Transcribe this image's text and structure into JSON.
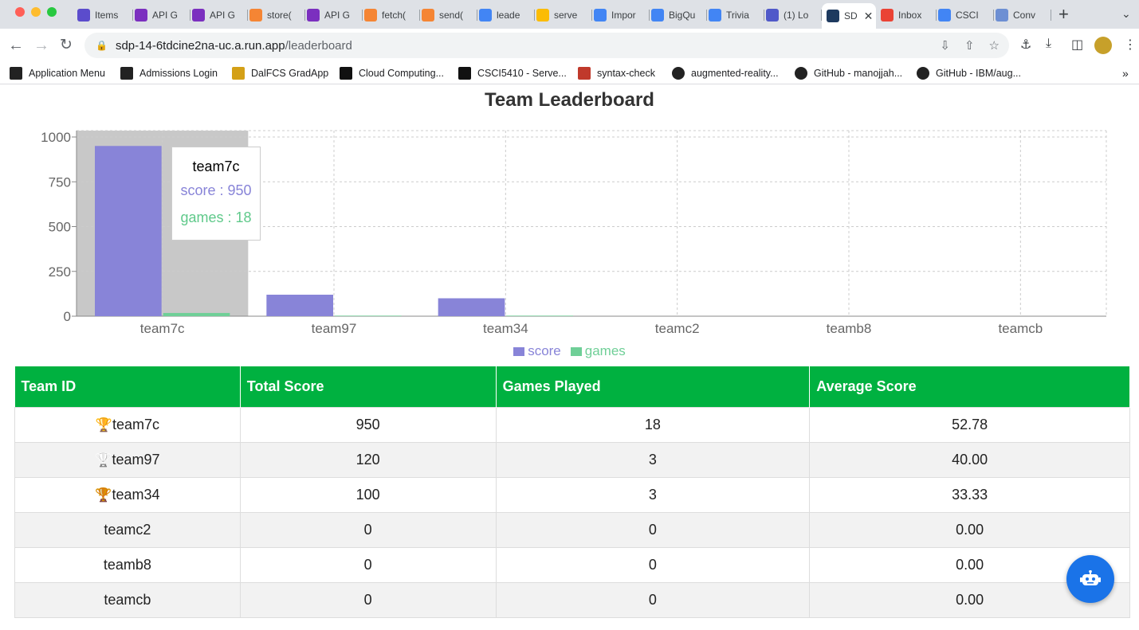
{
  "browser": {
    "tabs": [
      {
        "label": "Items",
        "icon": "notion-icon",
        "color": "#5b4ccc"
      },
      {
        "label": "API G",
        "icon": "api-gateway-icon",
        "color": "#7b2fbf"
      },
      {
        "label": "API G",
        "icon": "api-gateway-icon",
        "color": "#7b2fbf"
      },
      {
        "label": "store(",
        "icon": "lambda-icon",
        "color": "#f58534"
      },
      {
        "label": "API G",
        "icon": "api-gateway-icon",
        "color": "#7b2fbf"
      },
      {
        "label": "fetch(",
        "icon": "lambda-icon",
        "color": "#f58534"
      },
      {
        "label": "send(",
        "icon": "lambda-icon",
        "color": "#f58534"
      },
      {
        "label": "leade",
        "icon": "code-icon",
        "color": "#4285f4"
      },
      {
        "label": "serve",
        "icon": "firebase-icon",
        "color": "#fbbc04"
      },
      {
        "label": "Impor",
        "icon": "stream-icon",
        "color": "#4285f4"
      },
      {
        "label": "BigQu",
        "icon": "bigquery-icon",
        "color": "#4285f4"
      },
      {
        "label": "Trivia",
        "icon": "trivia-icon",
        "color": "#4285f4"
      },
      {
        "label": "(1) Lo",
        "icon": "teams-icon",
        "color": "#5059c9"
      },
      {
        "label": "SD",
        "icon": "react-icon",
        "color": "#1e3a5f",
        "active": true
      },
      {
        "label": "Inbox",
        "icon": "gmail-icon",
        "color": "#ea4335"
      },
      {
        "label": "CSCI",
        "icon": "docs-icon",
        "color": "#4285f4"
      },
      {
        "label": "Conv",
        "icon": "convert-icon",
        "color": "#6d8fd3"
      }
    ],
    "url_host": "sdp-14-6tdcine2na-uc.a.run.app",
    "url_path": "/leaderboard",
    "bookmarks": [
      {
        "label": "Application Menu",
        "icon": "dal-shield-icon"
      },
      {
        "label": "Admissions Login",
        "icon": "dal-shield-icon"
      },
      {
        "label": "DalFCS GradApp",
        "icon": "graduation-cap-icon"
      },
      {
        "label": "Cloud Computing...",
        "icon": "d2l-icon"
      },
      {
        "label": "CSCI5410 - Serve...",
        "icon": "d2l-icon"
      },
      {
        "label": "syntax-check",
        "icon": "syntax-check-icon"
      },
      {
        "label": "augmented-reality...",
        "icon": "github-icon"
      },
      {
        "label": "GitHub - manojjah...",
        "icon": "github-icon"
      },
      {
        "label": "GitHub - IBM/aug...",
        "icon": "github-icon"
      }
    ]
  },
  "page": {
    "title": "Team Leaderboard",
    "tooltip": {
      "team": "team7c",
      "score_text": "score : 950",
      "games_text": "games : 18"
    },
    "table": {
      "headers": [
        "Team ID",
        "Total Score",
        "Games Played",
        "Average Score"
      ],
      "rows": [
        {
          "team": "team7c",
          "score": "950",
          "games": "18",
          "avg": "52.78",
          "trophy": "gold"
        },
        {
          "team": "team97",
          "score": "120",
          "games": "3",
          "avg": "40.00",
          "trophy": "silver"
        },
        {
          "team": "team34",
          "score": "100",
          "games": "3",
          "avg": "33.33",
          "trophy": "bronze"
        },
        {
          "team": "teamc2",
          "score": "0",
          "games": "0",
          "avg": "0.00",
          "trophy": ""
        },
        {
          "team": "teamb8",
          "score": "0",
          "games": "0",
          "avg": "0.00",
          "trophy": ""
        },
        {
          "team": "teamcb",
          "score": "0",
          "games": "0",
          "avg": "0.00",
          "trophy": ""
        }
      ]
    },
    "colors": {
      "header_green": "#00b140",
      "gold": "#f5c400",
      "silver": "#b8b8b8",
      "bronze": "#cd7a10",
      "bot_blue": "#1a73e8"
    },
    "bot_icon": "robot-icon"
  },
  "chart_data": {
    "type": "bar",
    "title": "Team Leaderboard",
    "categories": [
      "team7c",
      "team97",
      "team34",
      "teamc2",
      "teamb8",
      "teamcb"
    ],
    "series": [
      {
        "name": "score",
        "values": [
          950,
          120,
          100,
          0,
          0,
          0
        ],
        "color": "#8884d8"
      },
      {
        "name": "games",
        "values": [
          18,
          3,
          3,
          0,
          0,
          0
        ],
        "color": "#6fcf97"
      }
    ],
    "yticks": [
      0,
      250,
      500,
      750,
      1000
    ],
    "ylim": [
      0,
      1000
    ],
    "grid": true,
    "legend": "bottom",
    "highlighted_category": "team7c"
  }
}
